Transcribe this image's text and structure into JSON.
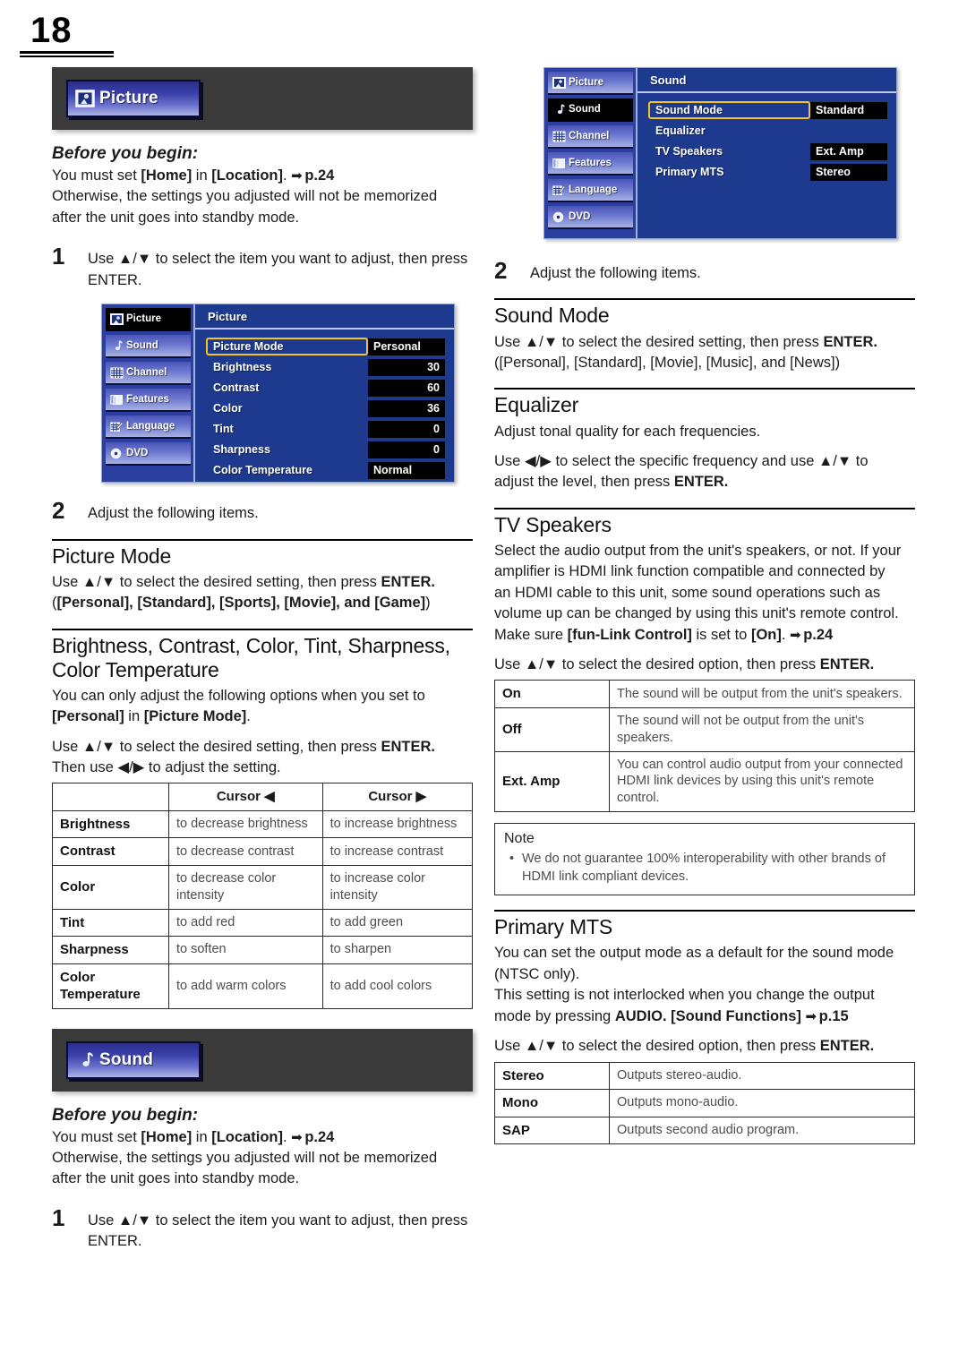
{
  "page": {
    "number": "18"
  },
  "left": {
    "banner": {
      "label": "Picture",
      "icon": "picture-icon"
    },
    "before_you_begin": {
      "heading": "Before you begin:",
      "line1_pre": "You must set ",
      "line1_home": "[Home]",
      "line1_mid": " in ",
      "line1_location": "[Location]",
      "line1_dot": ".",
      "line1_arrow": "➡",
      "line1_page": "p.24",
      "line2": "Otherwise, the settings you adjusted will not be memorized",
      "line3": "after the unit goes into standby mode."
    },
    "step1": {
      "num": "1",
      "line1": "Use ▲/▼ to select the item you want to adjust, then press",
      "line2": "ENTER."
    },
    "osd": {
      "title": "Picture",
      "sidebar": [
        {
          "label": "Picture",
          "icon": "picture-icon",
          "active": true
        },
        {
          "label": "Sound",
          "icon": "sound-note-icon",
          "active": false
        },
        {
          "label": "Channel",
          "icon": "channel-grid-icon",
          "active": false
        },
        {
          "label": "Features",
          "icon": "features-layers-icon",
          "active": false
        },
        {
          "label": "Language",
          "icon": "language-pencil-icon",
          "active": false
        },
        {
          "label": "DVD",
          "icon": "dvd-disc-icon",
          "active": false
        }
      ],
      "rows": [
        {
          "label": "Picture Mode",
          "value": "Personal",
          "selected": true,
          "numeric": false
        },
        {
          "label": "Brightness",
          "value": "30",
          "selected": false,
          "numeric": true
        },
        {
          "label": "Contrast",
          "value": "60",
          "selected": false,
          "numeric": true
        },
        {
          "label": "Color",
          "value": "36",
          "selected": false,
          "numeric": true
        },
        {
          "label": "Tint",
          "value": "0",
          "selected": false,
          "numeric": true
        },
        {
          "label": "Sharpness",
          "value": "0",
          "selected": false,
          "numeric": true
        },
        {
          "label": "Color Temperature",
          "value": "Normal",
          "selected": false,
          "numeric": false
        }
      ]
    },
    "step2": {
      "num": "2",
      "text": "Adjust the following items."
    },
    "picture_mode": {
      "heading": "Picture Mode",
      "line1": "Use ▲/▼ to select the desired setting, then press ",
      "line1_enter": "ENTER.",
      "options_prefix": "(",
      "options": "[Personal], [Standard], [Sports], [Movie], and [Game]",
      "options_suffix": ")"
    },
    "adjust_section": {
      "heading_line1": "Brightness, Contrast, Color, Tint, Sharpness,",
      "heading_line2": "Color Temperature",
      "body_line1": "You can only adjust the following options when you set to",
      "body_line2_pre": "",
      "body_personal": "[Personal]",
      "body_mid": " in ",
      "body_picture_mode": "[Picture Mode]",
      "body_end": ".",
      "use_line1": "Use ▲/▼ to select the desired setting, then press ",
      "use_enter": "ENTER.",
      "use_line2": "Then use ◀/▶ to adjust the setting."
    },
    "cursor_table": {
      "headers": [
        "",
        "Cursor ◀",
        "Cursor ▶"
      ],
      "rows": [
        {
          "key": "Brightness",
          "left": "to decrease brightness",
          "right": "to increase brightness"
        },
        {
          "key": "Contrast",
          "left": "to decrease contrast",
          "right": "to increase contrast"
        },
        {
          "key": "Color",
          "left": "to decrease color intensity",
          "right": "to increase color intensity"
        },
        {
          "key": "Tint",
          "left": "to add red",
          "right": "to add green"
        },
        {
          "key": "Sharpness",
          "left": "to soften",
          "right": "to sharpen"
        },
        {
          "key": "Color Temperature",
          "left": "to add warm colors",
          "right": "to add cool colors"
        }
      ]
    },
    "banner2": {
      "label": "Sound",
      "icon": "sound-note-icon"
    },
    "before_you_begin2": {
      "heading": "Before you begin:",
      "line1_pre": "You must set ",
      "line1_home": "[Home]",
      "line1_mid": " in ",
      "line1_location": "[Location]",
      "line1_dot": ".",
      "line1_arrow": "➡",
      "line1_page": "p.24",
      "line2": "Otherwise, the settings you adjusted will not be memorized",
      "line3": "after the unit goes into standby mode."
    },
    "step1b": {
      "num": "1",
      "line1": "Use ▲/▼ to select the item you want to adjust, then press",
      "line2": "ENTER."
    }
  },
  "right": {
    "osd": {
      "title": "Sound",
      "sidebar": [
        {
          "label": "Picture",
          "icon": "picture-icon",
          "active": false
        },
        {
          "label": "Sound",
          "icon": "sound-note-icon",
          "active": true
        },
        {
          "label": "Channel",
          "icon": "channel-grid-icon",
          "active": false
        },
        {
          "label": "Features",
          "icon": "features-layers-icon",
          "active": false
        },
        {
          "label": "Language",
          "icon": "language-pencil-icon",
          "active": false
        },
        {
          "label": "DVD",
          "icon": "dvd-disc-icon",
          "active": false
        }
      ],
      "rows": [
        {
          "label": "Sound Mode",
          "value": "Standard",
          "selected": true,
          "hasValue": true
        },
        {
          "label": "Equalizer",
          "value": "",
          "selected": false,
          "hasValue": false
        },
        {
          "label": "TV Speakers",
          "value": "Ext. Amp",
          "selected": false,
          "hasValue": true
        },
        {
          "label": "Primary MTS",
          "value": "Stereo",
          "selected": false,
          "hasValue": true
        }
      ]
    },
    "step2": {
      "num": "2",
      "text": "Adjust the following items."
    },
    "sound_mode": {
      "heading": "Sound Mode",
      "line1": "Use ▲/▼ to select the desired setting, then press ",
      "line1_enter": "ENTER.",
      "options": "([Personal], [Standard], [Movie], [Music], and [News])"
    },
    "equalizer": {
      "heading": "Equalizer",
      "line1": "Adjust tonal quality for each frequencies.",
      "line2": "Use ◀/▶ to select the specific frequency and use ▲/▼ to",
      "line3_pre": "adjust the level, then press ",
      "line3_enter": "ENTER."
    },
    "tv_speakers": {
      "heading": "TV Speakers",
      "p1_l1": "Select the audio output from the unit's speakers, or not. If your",
      "p1_l2": "amplifier is HDMI link function compatible and connected by",
      "p1_l3": "an HDMI cable to this unit, some sound operations such as",
      "p1_l4": "volume up can be changed by using this unit's remote control.",
      "p1_l5_pre": "Make sure ",
      "p1_l5_bracket1": "[fun-Link Control]",
      "p1_l5_mid": " is set to ",
      "p1_l5_bracket2": "[On]",
      "p1_l5_dot": ".",
      "p1_l5_arrow": "➡",
      "p1_l5_page": "p.24",
      "use_line_pre": "Use ▲/▼ to select the desired option, then press ",
      "use_line_enter": "ENTER.",
      "table_rows": [
        {
          "key": "On",
          "desc": "The sound will be output from the unit's speakers."
        },
        {
          "key": "Off",
          "desc": "The sound will not be output from the unit's speakers."
        },
        {
          "key": "Ext. Amp",
          "desc": "You can control audio output from your connected HDMI link devices by using this unit's remote control."
        }
      ]
    },
    "note": {
      "title": "Note",
      "bullet": "•",
      "text": "We do not guarantee 100% interoperability with other brands of HDMI link compliant devices."
    },
    "primary_mts": {
      "heading": "Primary MTS",
      "p1_l1": "You can set the output mode as a default for the sound mode",
      "p1_l2": "(NTSC only).",
      "p1_l3": "This setting is not interlocked when you change the output",
      "p1_l4_pre": "mode by pressing ",
      "p1_l4_audio": "AUDIO. [Sound Functions]",
      "p1_l4_arrow": "➡",
      "p1_l4_page": "p.15",
      "use_line_pre": "Use ▲/▼ to select the desired option, then press ",
      "use_line_enter": "ENTER.",
      "table_rows": [
        {
          "key": "Stereo",
          "desc": "Outputs stereo-audio."
        },
        {
          "key": "Mono",
          "desc": "Outputs mono-audio."
        },
        {
          "key": "SAP",
          "desc": "Outputs second audio program."
        }
      ]
    }
  },
  "colors": {
    "banner_bg": "#3a3a3a",
    "osd_blue": "#1e3a8f",
    "osd_highlight": "#f5c518",
    "text": "#1c1c1c",
    "table_text": "#4d4d4d"
  }
}
